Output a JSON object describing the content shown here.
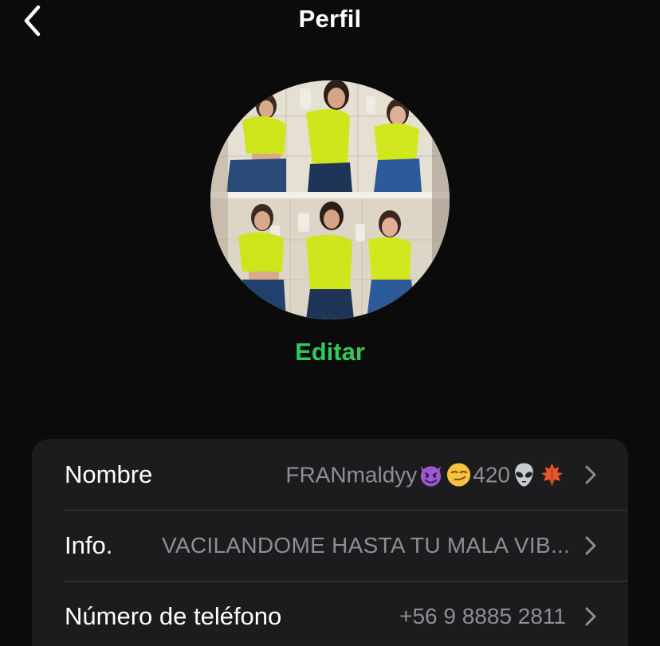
{
  "nav": {
    "title": "Perfil",
    "back_icon": "chevron-left-icon"
  },
  "profile": {
    "edit_label": "Editar",
    "accent_color": "#34c759"
  },
  "fields": {
    "name": {
      "label": "Nombre",
      "value_text_1": "FRANmaldyy",
      "value_text_2": "420",
      "emojis": [
        "smiling-imp-icon",
        "smirk-face-icon",
        "alien-icon",
        "maple-leaf-icon"
      ]
    },
    "info": {
      "label": "Info.",
      "value": "VACILANDOME HASTA TU MALA VIB..."
    },
    "phone": {
      "label": "Número de teléfono",
      "value": "+56 9 8885 2811"
    }
  }
}
